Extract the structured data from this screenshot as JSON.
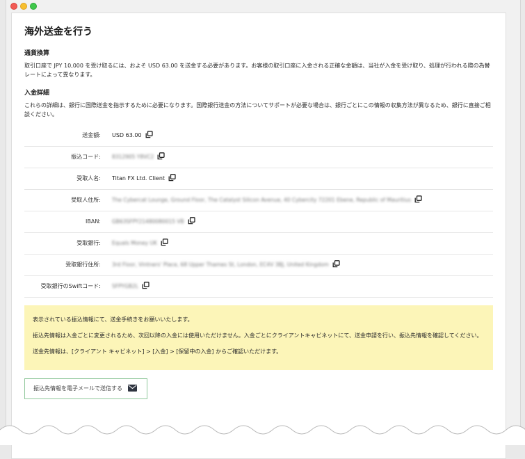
{
  "page": {
    "title": "海外送金を行う"
  },
  "currency": {
    "heading": "通貨換算",
    "text": "取引口座で JPY 10,000 を受け取るには、およそ USD 63.00 を送金する必要があります。お客様の取引口座に入金される正確な金額は、当社が入金を受け取り、処理が行われる際の為替レートによって異なります。"
  },
  "deposit": {
    "heading": "入金詳細",
    "text": "これらの詳細は、銀行に国際送金を指示するために必要になります。国際銀行送金の方法についてサポートが必要な場合は、銀行ごとにこの情報の収集方法が異なるため、銀行に直接ご相談ください。",
    "rows": [
      {
        "label": "送金額:",
        "value": "USD 63.00"
      },
      {
        "label": "振込コード:",
        "value": "8312905 Y8VC2"
      },
      {
        "label": "受取人名:",
        "value": "Titan FX Ltd. Client"
      },
      {
        "label": "受取人住所:",
        "value": "The Cybercat Lounge, Ground Floor, The Catalyst Silicon Avenue, 40 Cybercity 72201 Ebene, Republic of Mauritius"
      },
      {
        "label": "IBAN:",
        "value": "GB63SFPY21480080015 VB"
      },
      {
        "label": "受取銀行:",
        "value": "Equals Money UK"
      },
      {
        "label": "受取銀行住所:",
        "value": "3rd Floor, Vintners' Place, 68 Upper Thames St, London, EC4V 3BJ, United Kingdom"
      },
      {
        "label": "受取銀行のSwiftコード:",
        "value": "SFPYGB2L"
      }
    ]
  },
  "notice": {
    "line1": "表示されている振込情報にて、送金手続きをお願いいたします。",
    "line2": "振込先情報は入金ごとに変更されるため、次回以降の入金には使用いただけません。入金ごとにクライアントキャビネットにて、送金申請を行い、振込先情報を確認してください。",
    "line3": "送金先情報は、[クライアント キャビネット] > [入金] > [保留中の入金] からご確認いただけます。"
  },
  "email_button": {
    "label": "振込先情報を電子メールで送信する",
    "icon": "envelope-icon"
  },
  "colors": {
    "notice_bg": "#fcf5b8",
    "button_border": "#8fc79a"
  }
}
